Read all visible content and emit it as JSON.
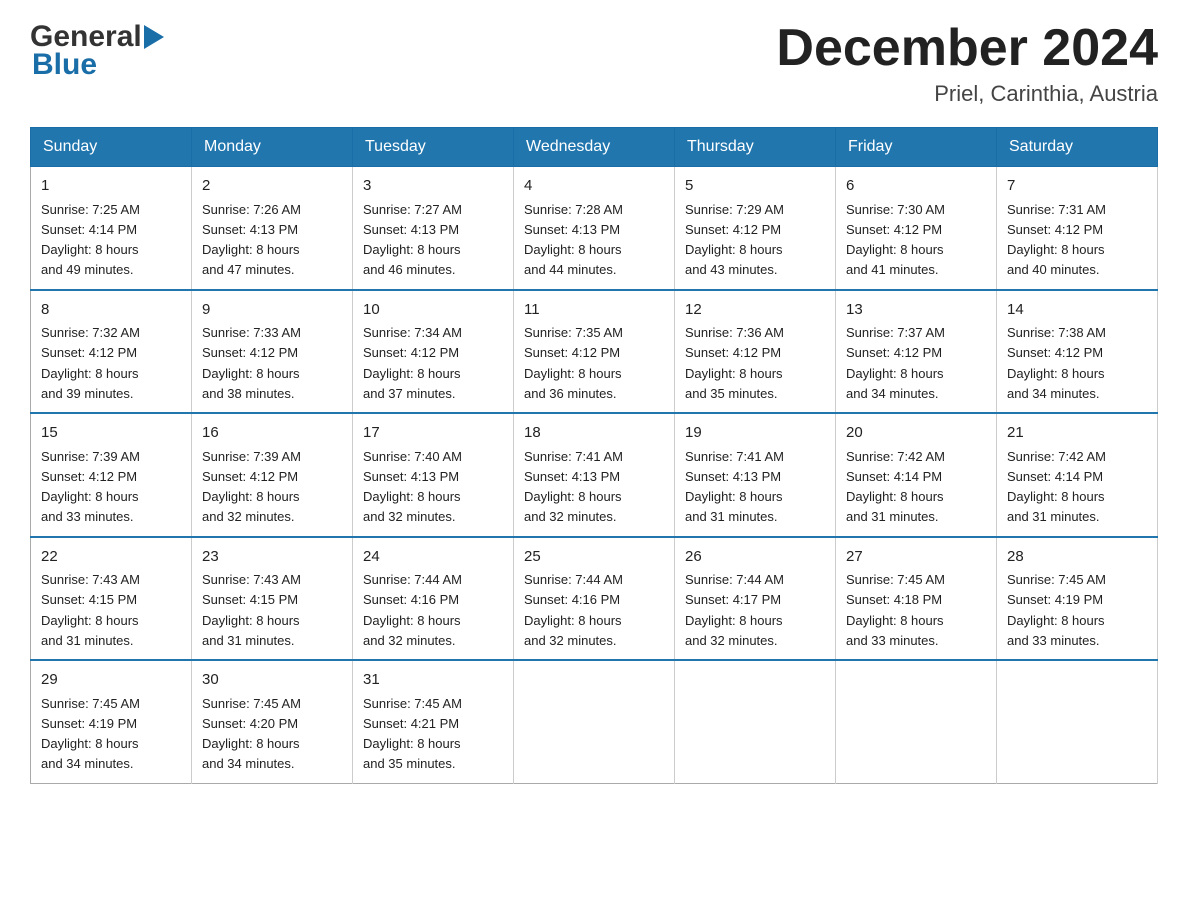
{
  "header": {
    "logo_general": "General",
    "logo_blue": "Blue",
    "month_title": "December 2024",
    "location": "Priel, Carinthia, Austria"
  },
  "calendar": {
    "days_of_week": [
      "Sunday",
      "Monday",
      "Tuesday",
      "Wednesday",
      "Thursday",
      "Friday",
      "Saturday"
    ],
    "weeks": [
      [
        {
          "day": "1",
          "sunrise": "Sunrise: 7:25 AM",
          "sunset": "Sunset: 4:14 PM",
          "daylight": "Daylight: 8 hours",
          "daylight2": "and 49 minutes."
        },
        {
          "day": "2",
          "sunrise": "Sunrise: 7:26 AM",
          "sunset": "Sunset: 4:13 PM",
          "daylight": "Daylight: 8 hours",
          "daylight2": "and 47 minutes."
        },
        {
          "day": "3",
          "sunrise": "Sunrise: 7:27 AM",
          "sunset": "Sunset: 4:13 PM",
          "daylight": "Daylight: 8 hours",
          "daylight2": "and 46 minutes."
        },
        {
          "day": "4",
          "sunrise": "Sunrise: 7:28 AM",
          "sunset": "Sunset: 4:13 PM",
          "daylight": "Daylight: 8 hours",
          "daylight2": "and 44 minutes."
        },
        {
          "day": "5",
          "sunrise": "Sunrise: 7:29 AM",
          "sunset": "Sunset: 4:12 PM",
          "daylight": "Daylight: 8 hours",
          "daylight2": "and 43 minutes."
        },
        {
          "day": "6",
          "sunrise": "Sunrise: 7:30 AM",
          "sunset": "Sunset: 4:12 PM",
          "daylight": "Daylight: 8 hours",
          "daylight2": "and 41 minutes."
        },
        {
          "day": "7",
          "sunrise": "Sunrise: 7:31 AM",
          "sunset": "Sunset: 4:12 PM",
          "daylight": "Daylight: 8 hours",
          "daylight2": "and 40 minutes."
        }
      ],
      [
        {
          "day": "8",
          "sunrise": "Sunrise: 7:32 AM",
          "sunset": "Sunset: 4:12 PM",
          "daylight": "Daylight: 8 hours",
          "daylight2": "and 39 minutes."
        },
        {
          "day": "9",
          "sunrise": "Sunrise: 7:33 AM",
          "sunset": "Sunset: 4:12 PM",
          "daylight": "Daylight: 8 hours",
          "daylight2": "and 38 minutes."
        },
        {
          "day": "10",
          "sunrise": "Sunrise: 7:34 AM",
          "sunset": "Sunset: 4:12 PM",
          "daylight": "Daylight: 8 hours",
          "daylight2": "and 37 minutes."
        },
        {
          "day": "11",
          "sunrise": "Sunrise: 7:35 AM",
          "sunset": "Sunset: 4:12 PM",
          "daylight": "Daylight: 8 hours",
          "daylight2": "and 36 minutes."
        },
        {
          "day": "12",
          "sunrise": "Sunrise: 7:36 AM",
          "sunset": "Sunset: 4:12 PM",
          "daylight": "Daylight: 8 hours",
          "daylight2": "and 35 minutes."
        },
        {
          "day": "13",
          "sunrise": "Sunrise: 7:37 AM",
          "sunset": "Sunset: 4:12 PM",
          "daylight": "Daylight: 8 hours",
          "daylight2": "and 34 minutes."
        },
        {
          "day": "14",
          "sunrise": "Sunrise: 7:38 AM",
          "sunset": "Sunset: 4:12 PM",
          "daylight": "Daylight: 8 hours",
          "daylight2": "and 34 minutes."
        }
      ],
      [
        {
          "day": "15",
          "sunrise": "Sunrise: 7:39 AM",
          "sunset": "Sunset: 4:12 PM",
          "daylight": "Daylight: 8 hours",
          "daylight2": "and 33 minutes."
        },
        {
          "day": "16",
          "sunrise": "Sunrise: 7:39 AM",
          "sunset": "Sunset: 4:12 PM",
          "daylight": "Daylight: 8 hours",
          "daylight2": "and 32 minutes."
        },
        {
          "day": "17",
          "sunrise": "Sunrise: 7:40 AM",
          "sunset": "Sunset: 4:13 PM",
          "daylight": "Daylight: 8 hours",
          "daylight2": "and 32 minutes."
        },
        {
          "day": "18",
          "sunrise": "Sunrise: 7:41 AM",
          "sunset": "Sunset: 4:13 PM",
          "daylight": "Daylight: 8 hours",
          "daylight2": "and 32 minutes."
        },
        {
          "day": "19",
          "sunrise": "Sunrise: 7:41 AM",
          "sunset": "Sunset: 4:13 PM",
          "daylight": "Daylight: 8 hours",
          "daylight2": "and 31 minutes."
        },
        {
          "day": "20",
          "sunrise": "Sunrise: 7:42 AM",
          "sunset": "Sunset: 4:14 PM",
          "daylight": "Daylight: 8 hours",
          "daylight2": "and 31 minutes."
        },
        {
          "day": "21",
          "sunrise": "Sunrise: 7:42 AM",
          "sunset": "Sunset: 4:14 PM",
          "daylight": "Daylight: 8 hours",
          "daylight2": "and 31 minutes."
        }
      ],
      [
        {
          "day": "22",
          "sunrise": "Sunrise: 7:43 AM",
          "sunset": "Sunset: 4:15 PM",
          "daylight": "Daylight: 8 hours",
          "daylight2": "and 31 minutes."
        },
        {
          "day": "23",
          "sunrise": "Sunrise: 7:43 AM",
          "sunset": "Sunset: 4:15 PM",
          "daylight": "Daylight: 8 hours",
          "daylight2": "and 31 minutes."
        },
        {
          "day": "24",
          "sunrise": "Sunrise: 7:44 AM",
          "sunset": "Sunset: 4:16 PM",
          "daylight": "Daylight: 8 hours",
          "daylight2": "and 32 minutes."
        },
        {
          "day": "25",
          "sunrise": "Sunrise: 7:44 AM",
          "sunset": "Sunset: 4:16 PM",
          "daylight": "Daylight: 8 hours",
          "daylight2": "and 32 minutes."
        },
        {
          "day": "26",
          "sunrise": "Sunrise: 7:44 AM",
          "sunset": "Sunset: 4:17 PM",
          "daylight": "Daylight: 8 hours",
          "daylight2": "and 32 minutes."
        },
        {
          "day": "27",
          "sunrise": "Sunrise: 7:45 AM",
          "sunset": "Sunset: 4:18 PM",
          "daylight": "Daylight: 8 hours",
          "daylight2": "and 33 minutes."
        },
        {
          "day": "28",
          "sunrise": "Sunrise: 7:45 AM",
          "sunset": "Sunset: 4:19 PM",
          "daylight": "Daylight: 8 hours",
          "daylight2": "and 33 minutes."
        }
      ],
      [
        {
          "day": "29",
          "sunrise": "Sunrise: 7:45 AM",
          "sunset": "Sunset: 4:19 PM",
          "daylight": "Daylight: 8 hours",
          "daylight2": "and 34 minutes."
        },
        {
          "day": "30",
          "sunrise": "Sunrise: 7:45 AM",
          "sunset": "Sunset: 4:20 PM",
          "daylight": "Daylight: 8 hours",
          "daylight2": "and 34 minutes."
        },
        {
          "day": "31",
          "sunrise": "Sunrise: 7:45 AM",
          "sunset": "Sunset: 4:21 PM",
          "daylight": "Daylight: 8 hours",
          "daylight2": "and 35 minutes."
        },
        null,
        null,
        null,
        null
      ]
    ]
  }
}
